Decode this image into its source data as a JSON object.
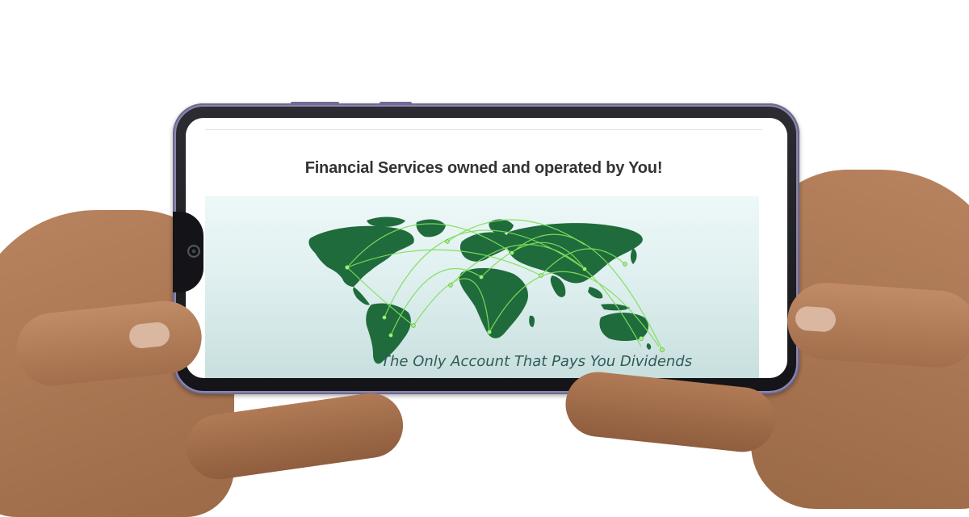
{
  "page": {
    "headline": "Financial Services owned and operated by You!",
    "tagline": "The Only Account That Pays You Dividends"
  },
  "banner": {
    "image": "world-map-network-icon",
    "colors": {
      "map": "#1f6b3c",
      "arcs": "#7fe05a",
      "background": "#dfefef"
    }
  },
  "device": {
    "type": "smartphone",
    "orientation": "landscape"
  }
}
